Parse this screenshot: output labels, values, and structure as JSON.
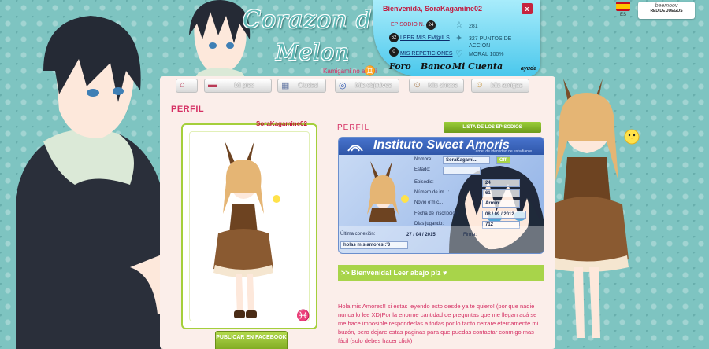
{
  "logo": {
    "line1": "Corazon de",
    "line2": "Melon",
    "sub": "Kamigami no asobi",
    "sign": "♊"
  },
  "user_panel": {
    "welcome": "Bienvenida, SoraKagamine02",
    "close_label": "x",
    "episode_label": "EPISODIO N.",
    "episode_number": "24",
    "stars": "281",
    "mails_badge": "62",
    "mails_link": "LEER MIS EM@ILS",
    "action_points": "327 PUNTOS DE ACCIÓN",
    "repeats_badge": "0",
    "repeats_link": "MIS REPETICIONES",
    "mood": "MORAL 100%",
    "links": [
      "Foro",
      "Banco",
      "Mi Cuenta"
    ],
    "help": "ayuda"
  },
  "lang": {
    "code": "ES"
  },
  "network": {
    "logo": "beemoov",
    "sub": "RED DE JUEGOS"
  },
  "nav": [
    {
      "label": "",
      "icon": "home-icon"
    },
    {
      "label": "Mi piso",
      "icon": "sofa-icon"
    },
    {
      "label": "Ciudad",
      "icon": "city-icon"
    },
    {
      "label": "Mis objetivos",
      "icon": "target-icon"
    },
    {
      "label": "Mis chicos",
      "icon": "boy-icon"
    },
    {
      "label": "Mis amigas",
      "icon": "girl-icon"
    }
  ],
  "profile": {
    "title": "PERFIL",
    "username": "SoraKagamine02",
    "publish_button": "PUBLICAR EN FACEBOOK",
    "zodiac": "♓",
    "heading": "PERFIL",
    "episodes_button": "LISTA DE LOS EPISODIOS"
  },
  "id_card": {
    "school": "Instituto Sweet Amoris",
    "school_sub": "Carnet de identidad de estudiante",
    "fields": [
      {
        "label": "Nombre:",
        "value": "SoraKagami..."
      },
      {
        "label": "Estado:",
        "value": ""
      },
      {
        "label": "Episodio:",
        "value": "24"
      },
      {
        "label": "Número de im...:",
        "value": "61"
      },
      {
        "label": "Novio o'm c...",
        "value": "Armin"
      },
      {
        "label": "Fecha de inscripción:",
        "value": "08 / 09 / 2012"
      },
      {
        "label": "Días jugando:",
        "value": "712"
      }
    ],
    "last_connection_label": "Última conexión:",
    "last_connection": "27 / 04 / 2015",
    "signature_label": "Firma:",
    "motto": "holas mis amores :'3",
    "status_badge": "Off"
  },
  "welcome_bar": ">> Bienvenida! Leer abajo plz ♥",
  "welcome_text": "Hola mis Amores!! si estas leyendo esto desde ya te quiero! (por que nadie nunca lo lee XD)Por la enorme cantidad de preguntas que me llegan acá se me hace imposible responderlas a todas por lo tanto cerrare eternamente mi buzón, pero dejare estas paginas para que puedas contactar conmigo mas fácil (solo debes hacer click)"
}
